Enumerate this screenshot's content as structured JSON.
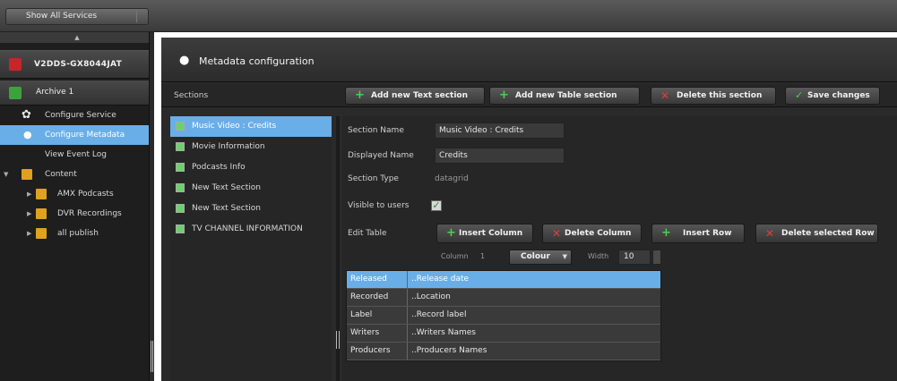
{
  "topbar": {
    "show_all_label": "Show All Services"
  },
  "sidebar": {
    "device_label": "V2DDS-GX8044JAT",
    "archive_label": "Archive 1",
    "items": [
      {
        "label": "Configure Service",
        "icon": "gear-icon"
      },
      {
        "label": "Configure Metadata",
        "icon": "lightbulb-icon",
        "selected": true
      },
      {
        "label": "View Event Log",
        "icon": ""
      },
      {
        "label": "Content",
        "icon": "folder-icon"
      },
      {
        "label": "AMX Podcasts",
        "icon": "folder-icon"
      },
      {
        "label": "DVR Recordings",
        "icon": "folder-icon"
      },
      {
        "label": "all publish",
        "icon": "folder-icon"
      }
    ]
  },
  "header": {
    "title": "Metadata configuration"
  },
  "toolbar": {
    "sections_label": "Sections",
    "add_text_label": "Add new Text section",
    "add_table_label": "Add new Table section",
    "delete_section_label": "Delete this section",
    "save_label": "Save changes"
  },
  "sections": [
    {
      "label": "Music Video : Credits",
      "selected": true
    },
    {
      "label": "Movie Information"
    },
    {
      "label": "Podcasts Info"
    },
    {
      "label": "New Text Section"
    },
    {
      "label": "New Text Section"
    },
    {
      "label": "TV CHANNEL INFORMATION"
    }
  ],
  "editor": {
    "section_name_label": "Section Name",
    "section_name_value": "Music Video : Credits",
    "displayed_name_label": "Displayed Name",
    "displayed_name_value": "Credits",
    "section_type_label": "Section Type",
    "section_type_value": "datagrid",
    "visible_label": "Visible to users",
    "visible_checked": true,
    "edit_table_label": "Edit Table",
    "insert_column_label": "Insert Column",
    "delete_column_label": "Delete Column",
    "insert_row_label": "Insert Row",
    "delete_row_label": "Delete selected Row",
    "column_label": "Column",
    "column_number": "1",
    "column_value": "Colour",
    "width_label": "Width",
    "width_value": "10",
    "table_rows": [
      {
        "key": "Released",
        "value": "..Release date",
        "selected": true
      },
      {
        "key": "Recorded",
        "value": "..Location"
      },
      {
        "key": "Label",
        "value": "..Record label"
      },
      {
        "key": "Writers",
        "value": "..Writers Names"
      },
      {
        "key": "Producers",
        "value": "..Producers Names"
      }
    ]
  },
  "colors": {
    "selection": "#6aaee8",
    "add_green": "#4fcf4f",
    "delete_red": "#e23b3b"
  }
}
